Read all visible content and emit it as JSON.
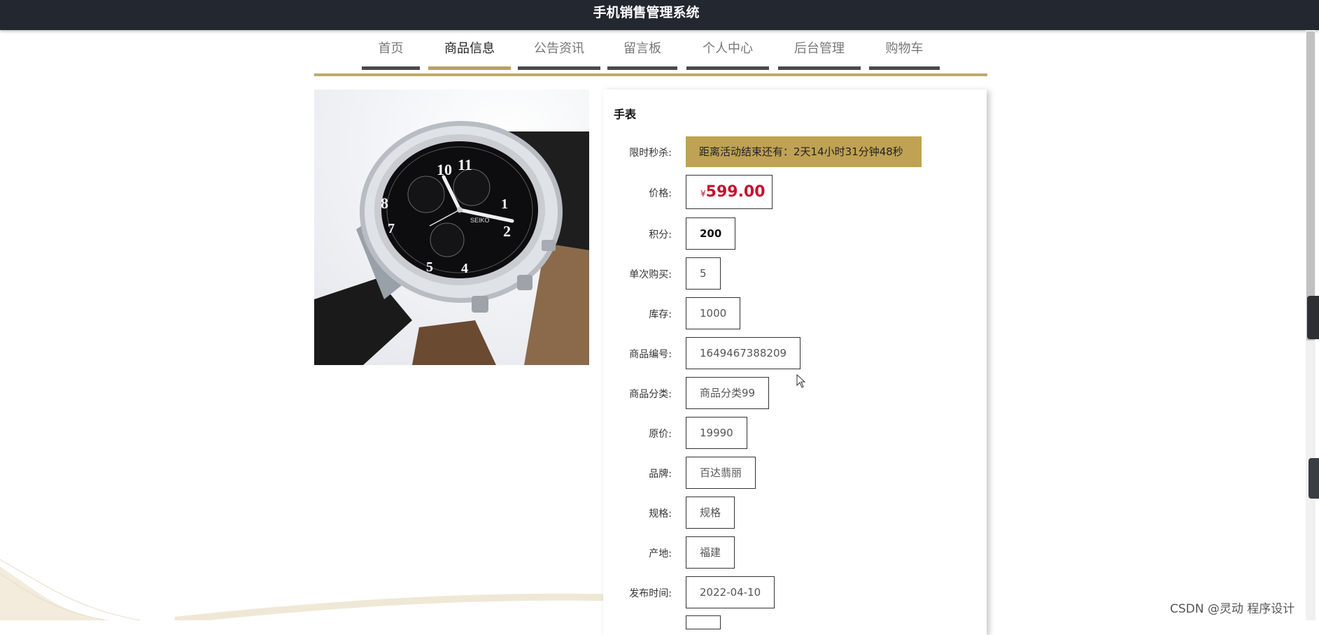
{
  "header": {
    "title": "手机销售管理系统"
  },
  "nav": {
    "items": [
      {
        "label": "首页"
      },
      {
        "label": "商品信息"
      },
      {
        "label": "公告资讯"
      },
      {
        "label": "留言板"
      },
      {
        "label": "个人中心"
      },
      {
        "label": "后台管理"
      },
      {
        "label": "购物车"
      }
    ],
    "active_index": 1
  },
  "colors": {
    "accent": "#bfa253",
    "price": "#c8102e",
    "topbar": "#23272f"
  },
  "product": {
    "name": "手表",
    "image_icon": "wristwatch-image",
    "flash_sale": {
      "label": "限时秒杀:",
      "text": "距离活动结束还有：2天14小时31分钟48秒"
    },
    "price": {
      "label": "价格:",
      "currency": "¥",
      "value": "599.00"
    },
    "points": {
      "label": "积分:",
      "value": "200"
    },
    "per_purchase": {
      "label": "单次购买:",
      "value": "5"
    },
    "stock": {
      "label": "库存:",
      "value": "1000"
    },
    "code": {
      "label": "商品编号:",
      "value": "1649467388209"
    },
    "category": {
      "label": "商品分类:",
      "value": "商品分类99"
    },
    "original_price": {
      "label": "原价:",
      "value": "19990"
    },
    "brand": {
      "label": "品牌:",
      "value": "百达翡丽"
    },
    "spec": {
      "label": "规格:",
      "value": "规格"
    },
    "origin": {
      "label": "产地:",
      "value": "福建"
    },
    "publish_time": {
      "label": "发布时间:",
      "value": "2022-04-10"
    }
  },
  "watermark": "CSDN @灵动 程序设计"
}
